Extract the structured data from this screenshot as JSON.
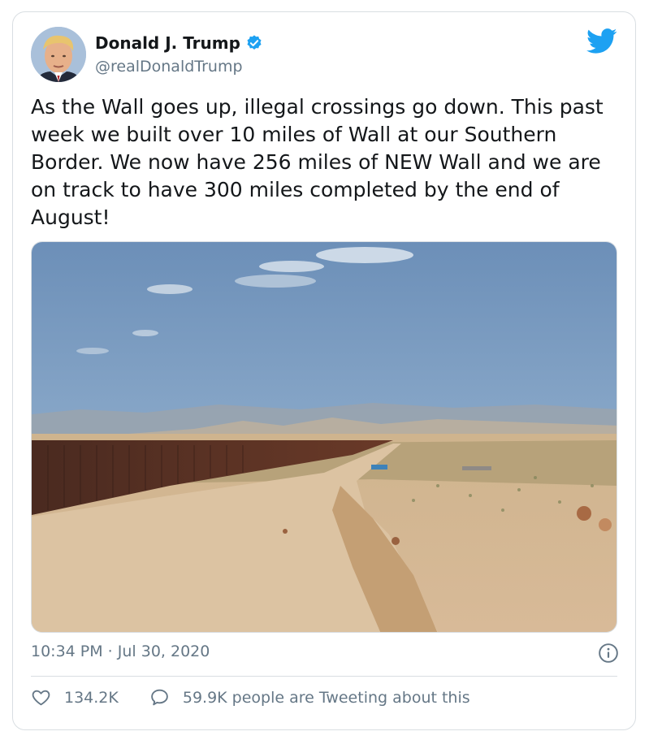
{
  "tweet": {
    "author_name": "Donald J. Trump",
    "handle": "@realDonaldTrump",
    "text": "As the Wall goes up, illegal crossings go down. This past week we built over 10 miles of Wall at our Southern Border. We now have 256 miles of NEW Wall and we are on track to have 300 miles completed by the end of August!",
    "timestamp": "10:34 PM · Jul 30, 2020"
  },
  "stats": {
    "likes": "134.2K",
    "conversation": "59.9K people are Tweeting about this"
  },
  "icons": {
    "verified": "verified-badge-icon",
    "brand": "twitter-bird-icon",
    "info": "info-icon",
    "like": "heart-icon",
    "reply": "speech-bubble-icon"
  },
  "colors": {
    "brand_blue": "#1da1f2",
    "text_primary": "#14171a",
    "text_secondary": "#657786",
    "border": "#d9dee2"
  }
}
